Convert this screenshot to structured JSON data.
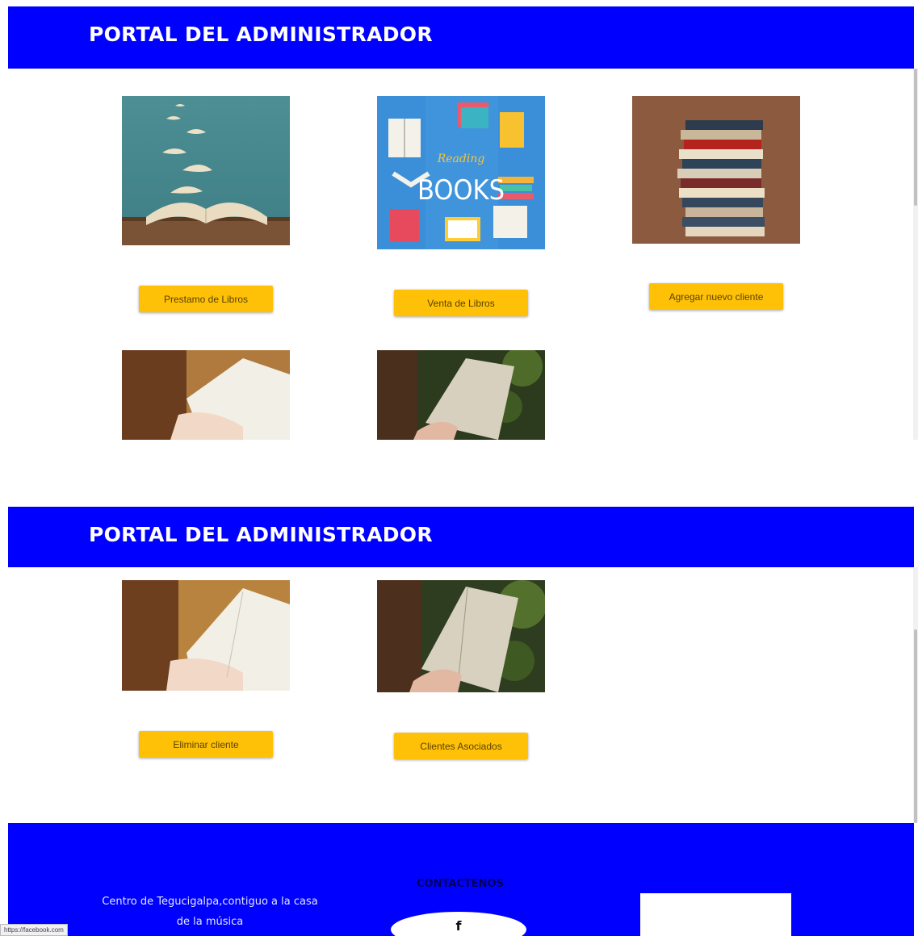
{
  "header": {
    "title": "PORTAL DEL ADMINISTRADOR"
  },
  "cards_top": [
    {
      "image_icon": "flying-pages-book-image",
      "button_label": "Prestamo de Libros"
    },
    {
      "image_icon": "reading-books-poster-image",
      "image_text_script": "Reading",
      "image_text_main": "BOOKS",
      "button_label": "Venta de Libros"
    },
    {
      "image_icon": "stacked-books-image",
      "button_label": "Agregar nuevo cliente"
    },
    {
      "image_icon": "hands-holding-book-image"
    },
    {
      "image_icon": "book-under-tree-image"
    }
  ],
  "cards_bottom": [
    {
      "image_icon": "hands-holding-book-image",
      "button_label": "Eliminar cliente"
    },
    {
      "image_icon": "book-under-tree-image",
      "button_label": "Clientes Asociados"
    }
  ],
  "footer": {
    "address_line1": "Centro de Tegucigalpa,contiguo a la casa",
    "address_line2": "de la música",
    "contact_heading": "CONTACTENOS",
    "facebook_glyph": "f",
    "facebook_icon": "facebook-icon"
  },
  "status_bar": {
    "url": "https://facebook.com"
  },
  "colors": {
    "header": "#0000ff",
    "button": "#ffc107",
    "page_bg": "#ffffff"
  }
}
